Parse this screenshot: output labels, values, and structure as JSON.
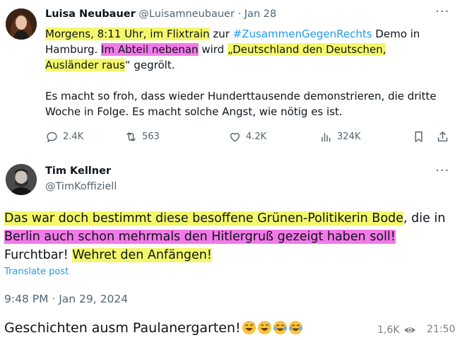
{
  "tweet1": {
    "name": "Luisa Neubauer",
    "handle": "@Luisamneubauer",
    "separator": " · ",
    "date": "Jan 28",
    "more": "···",
    "text": {
      "s1": "Morgens, 8:11 Uhr, im Flixtrain",
      "s2": " zur ",
      "hashtag": "#ZusammenGegenRechts",
      "s3": " Demo in Hamburg. ",
      "s4": "Im Abteil nebenan",
      "s5": " wird ",
      "s6": "„Deutschland den Deutschen, Ausländer raus",
      "s7": "“ gegrölt.",
      "p2": "Es macht so froh, dass wieder Hunderttausende demonstrieren, die dritte Woche in Folge. Es macht solche Angst, wie nötig es ist."
    },
    "actions": {
      "replies": "2.4K",
      "reposts": "563",
      "likes": "4.2K",
      "views": "324K"
    }
  },
  "tweet2": {
    "name": "Tim Kellner",
    "handle": "@TimKoffiziell",
    "more": "···",
    "text": {
      "s1": "Das war doch bestimmt diese besoffene Grünen-Politikerin Bode",
      "s2": ", die in ",
      "s3": "Berlin auch schon mehrmals den Hitlergruß gezeigt haben soll!",
      "s4": "Furchtbar! ",
      "s5": "Wehret den Anfängen!"
    },
    "translate": "Translate post",
    "timestamp": "9:48 PM · Jan 29, 2024"
  },
  "message": {
    "caption": "Geschichten ausm Paulanergarten!",
    "emojis": [
      "grinning-sweat-emoji",
      "grinning-sweat-emoji",
      "tears-of-joy-emoji",
      "tears-of-joy-emoji"
    ],
    "views": "1,6K",
    "time": "21:50"
  },
  "colors": {
    "highlight_yellow": "#f4f86a",
    "highlight_pink": "#f27ae8",
    "link_blue": "#1d9bf0",
    "secondary_gray": "#536471"
  }
}
